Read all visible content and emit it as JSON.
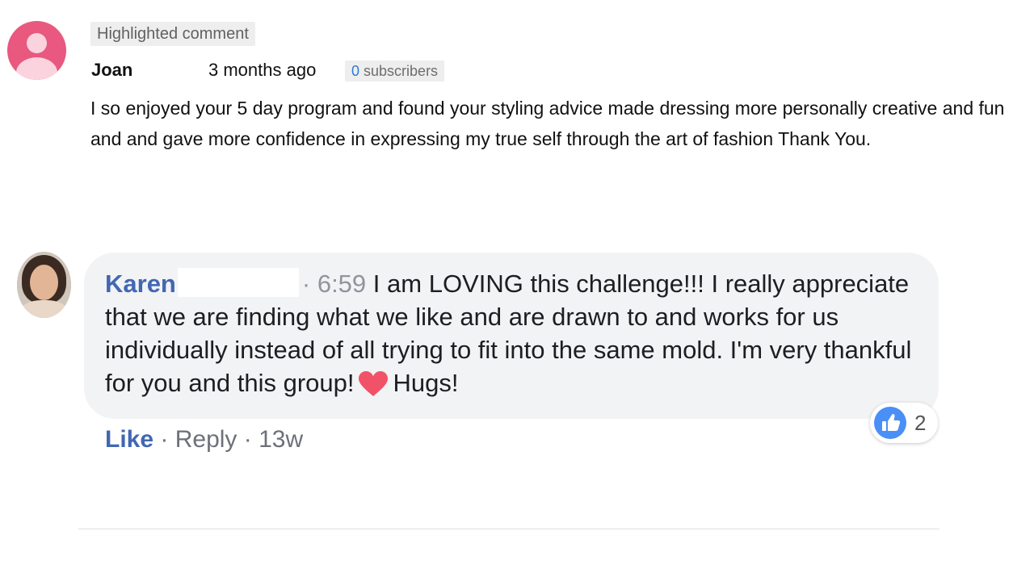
{
  "youtube_comment": {
    "badge": "Highlighted comment",
    "author": "Joan",
    "time": "3 months ago",
    "subscribers_count": "0",
    "subscribers_label": "subscribers",
    "text": "I so enjoyed your 5 day program and found your styling  advice made dressing  more personally creative and fun and  and gave  more confidence in expressing my true  self through the art of fashion Thank You.",
    "avatar_icon": "user-silhouette-icon"
  },
  "facebook_comment": {
    "author": "Karen",
    "separator": "·",
    "timestamp": "6:59",
    "text": "I am LOVING this challenge!!! I really appreciate that we are finding what we like and are drawn to and works for us individually instead of all trying to fit into the same mold. I'm very thankful for you and this group!",
    "after_emoji": "Hugs!",
    "emoji_icon": "red-heart-icon",
    "actions": {
      "like": "Like",
      "dot1": "·",
      "reply": "Reply",
      "dot2": "·",
      "age": "13w"
    },
    "reaction_icon": "thumbs-up-icon",
    "reaction_count": "2"
  },
  "colors": {
    "fb_link": "#4267b2",
    "bubble_bg": "#f2f3f5",
    "yt_avatar": "#e8587f",
    "like_blue": "#4a8ff5",
    "heart_red": "#f25268"
  }
}
